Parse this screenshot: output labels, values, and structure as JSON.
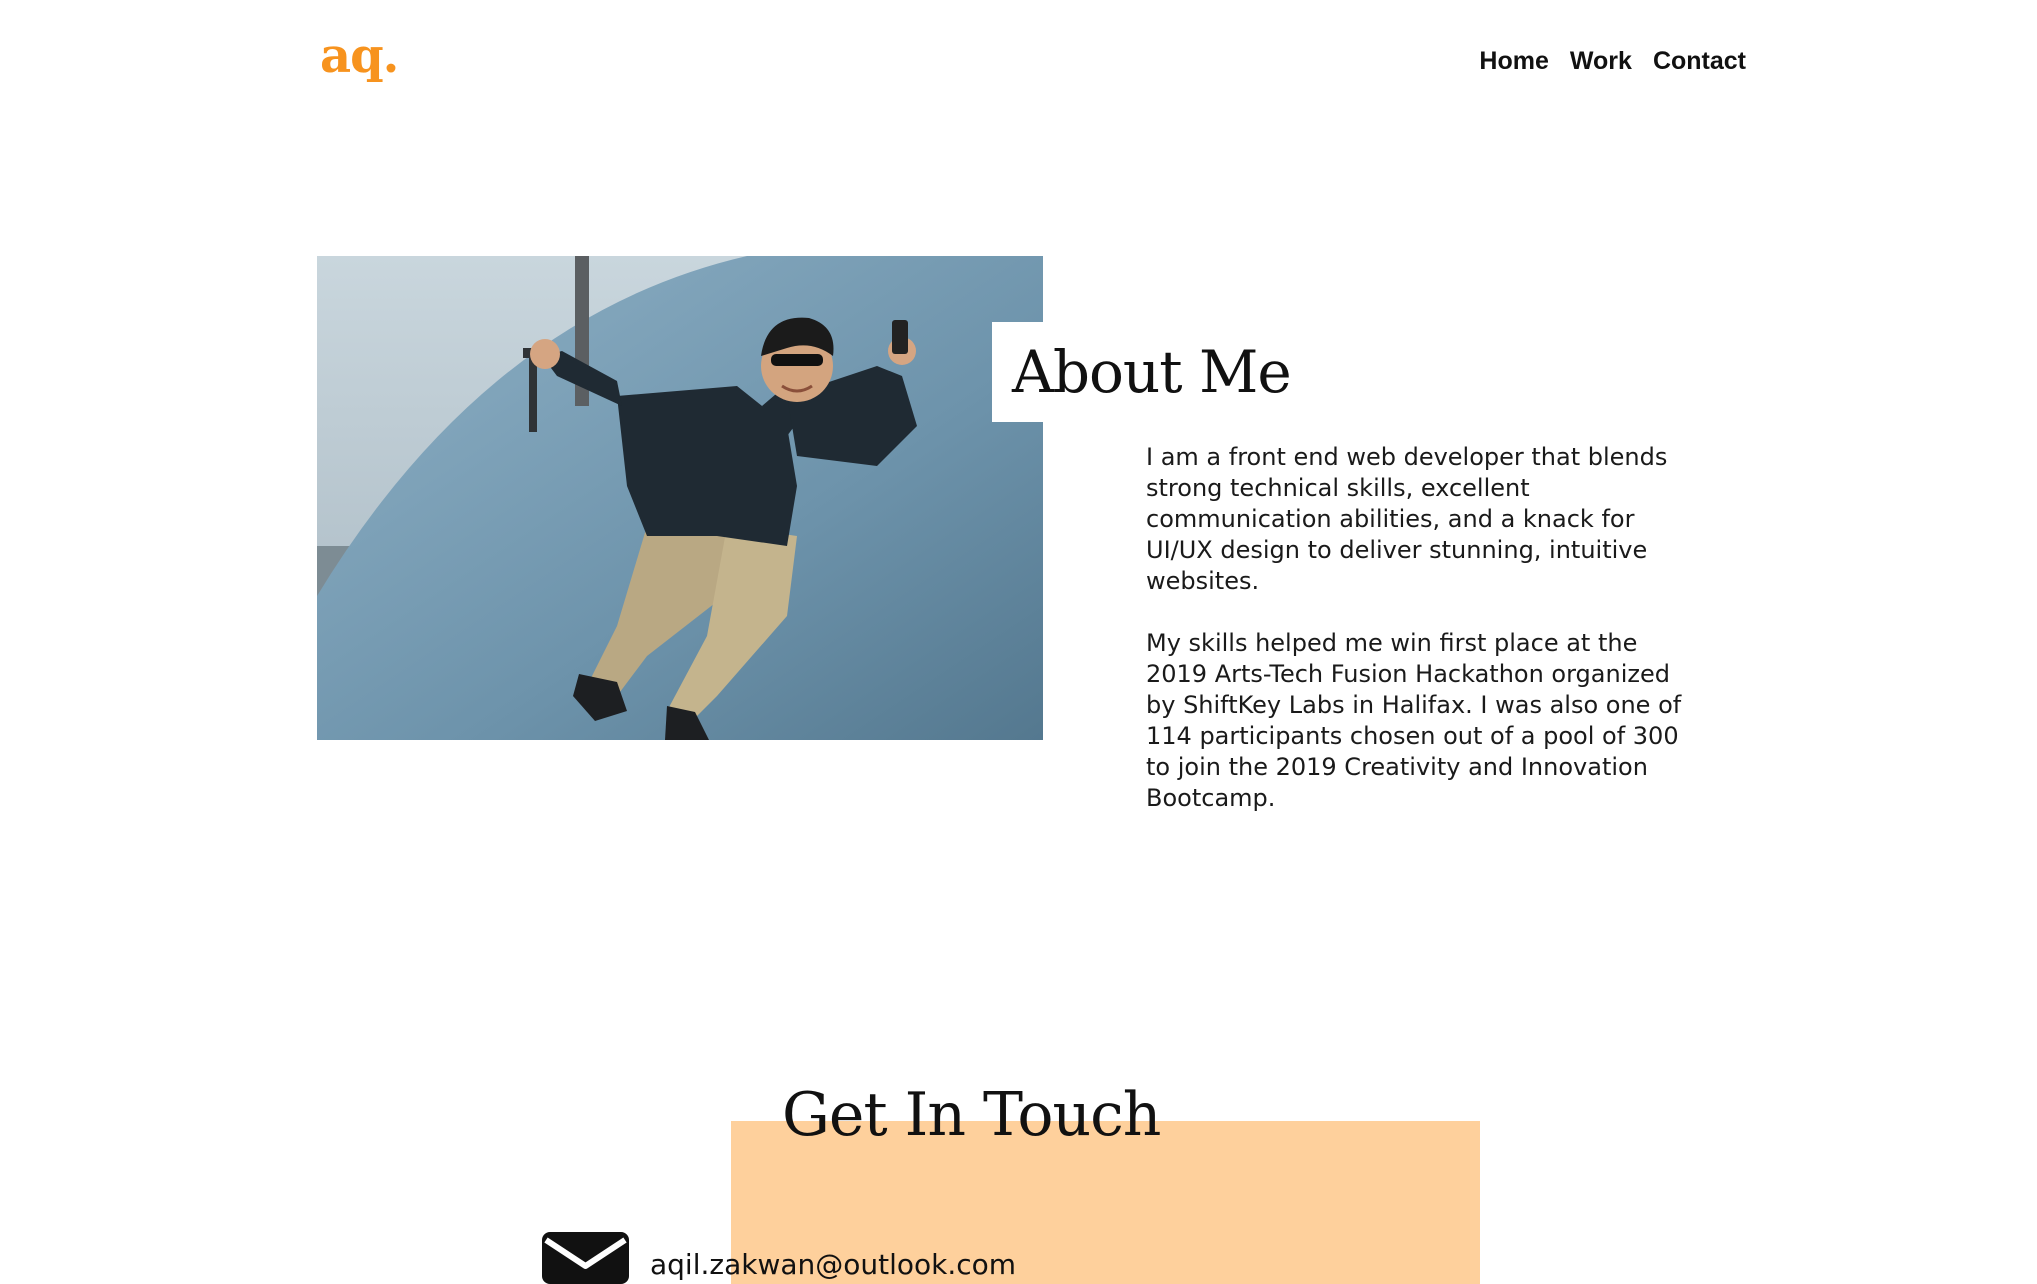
{
  "header": {
    "logo_text": "aq.",
    "nav": [
      {
        "label": "Home"
      },
      {
        "label": "Work"
      },
      {
        "label": "Contact"
      }
    ]
  },
  "about": {
    "title": "About Me",
    "paragraphs": [
      "I am a front end web developer that blends strong technical skills, excellent communication abilities, and a knack for UI/UX design to deliver stunning, intuitive websites.",
      "My skills helped me win first place at the 2019 Arts-Tech Fusion Hackathon organized by ShiftKey Labs in Halifax. I was also one of 114 participants chosen out of a pool of 300 to join the 2019 Creativity and Innovation Bootcamp."
    ]
  },
  "contact": {
    "title": "Get In Touch",
    "email": "aqil.zakwan@outlook.com",
    "email_icon": "envelope-icon"
  },
  "colors": {
    "accent": "#f7931e",
    "contact_band": "#fed09c",
    "text": "#111111",
    "background": "#ffffff"
  }
}
